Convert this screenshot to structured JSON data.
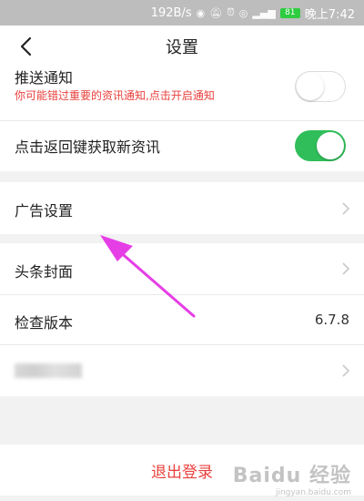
{
  "status_bar": {
    "speed": "192B/s",
    "battery": "81",
    "time": "晚上7:42"
  },
  "nav": {
    "title": "设置"
  },
  "notifications": {
    "label": "推送通知",
    "subtitle": "你可能错过重要的资讯通知,点击开启通知",
    "toggle_on": false
  },
  "refresh": {
    "label": "点击返回键获取新资讯",
    "toggle_on": true
  },
  "ads": {
    "label": "广告设置"
  },
  "cover": {
    "label": "头条封面"
  },
  "version": {
    "label": "检查版本",
    "value": "6.7.8"
  },
  "logout": {
    "label": "退出登录"
  },
  "watermark": {
    "brand": "Baidu 经验",
    "url": "jingyan.baidu.com"
  },
  "colors": {
    "accent_red": "#e8413d",
    "toggle_green": "#2fbe5a",
    "annotation_arrow": "#e63ee6"
  }
}
